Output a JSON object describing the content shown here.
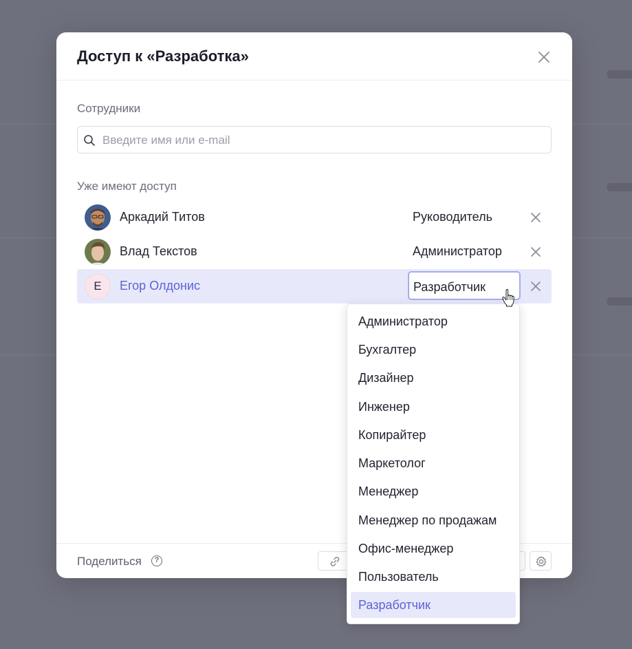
{
  "modal": {
    "title": "Доступ к «Разработка»",
    "employees_label": "Сотрудники",
    "search_placeholder": "Введите имя или e-mail",
    "has_access_label": "Уже имеют доступ",
    "members": [
      {
        "name": "Аркадий Титов",
        "role": "Руководитель",
        "avatar": "photo"
      },
      {
        "name": "Влад Текстов",
        "role": "Администратор",
        "avatar": "photo"
      },
      {
        "name": "Егор Олдонис",
        "role": "Разработчик",
        "avatar_letter": "Е",
        "active": true
      }
    ],
    "footer": {
      "share_label": "Поделиться",
      "help_glyph": "?"
    }
  },
  "role_dropdown": {
    "options": [
      "Администратор",
      "Бухгалтер",
      "Дизайнер",
      "Инженер",
      "Копирайтер",
      "Маркетолог",
      "Менеджер",
      "Менеджер по продажам",
      "Офис-менеджер",
      "Пользователь",
      "Разработчик"
    ],
    "selected": "Разработчик"
  },
  "colors": {
    "accent": "#5c62d6",
    "accent_bg": "#e7e9fb",
    "overlay": "#6f707d"
  }
}
